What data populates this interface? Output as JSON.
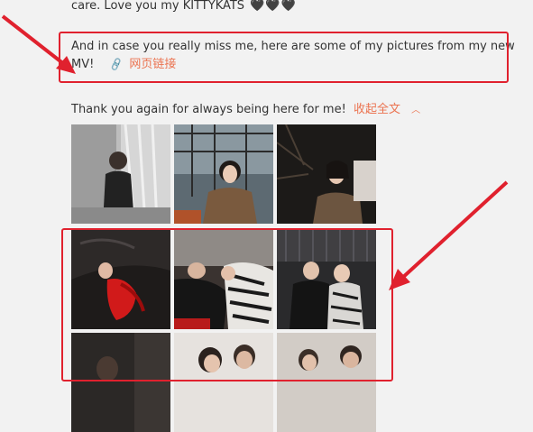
{
  "post": {
    "line1": "care. Love you my KITTYKATS",
    "hearts": "🖤🖤🖤",
    "para2_line1": "And in case you really miss me, here are some of my pictures from my new",
    "para2_line2": "MV!",
    "link_icon": "link-icon",
    "link_label": "网页链接",
    "para3": "Thank you again for always being here for me!",
    "collapse_label": "收起全文",
    "collapse_chevron": "^"
  },
  "photos": [
    {
      "name": "photo-1",
      "desc": "woman-curtain-window"
    },
    {
      "name": "photo-2",
      "desc": "woman-city-balcony"
    },
    {
      "name": "photo-3",
      "desc": "woman-dark-branches"
    },
    {
      "name": "photo-4",
      "desc": "woman-red-dress-leather-sofa"
    },
    {
      "name": "photo-5",
      "desc": "couple-lying-zebra-print"
    },
    {
      "name": "photo-6",
      "desc": "couple-seated-dark-room"
    },
    {
      "name": "photo-7",
      "desc": "dark-scene"
    },
    {
      "name": "photo-8",
      "desc": "couple-close"
    },
    {
      "name": "photo-9",
      "desc": "couple-portrait"
    }
  ],
  "colors": {
    "background": "#f2f2f2",
    "text": "#333333",
    "link": "#eb7350",
    "annotation": "#e0212e"
  }
}
